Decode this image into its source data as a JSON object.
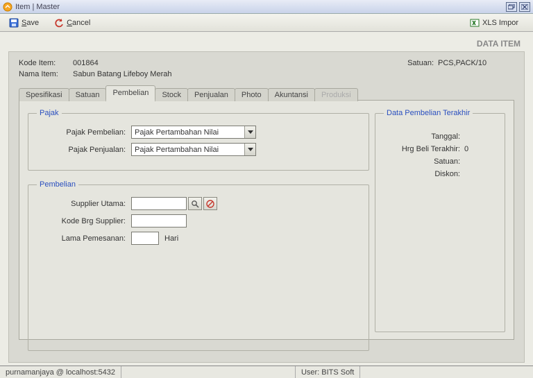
{
  "window": {
    "title": "Item | Master"
  },
  "toolbar": {
    "save_label": "Save",
    "save_key": "S",
    "cancel_label": "Cancel",
    "cancel_key": "C",
    "xls_label": "XLS Impor"
  },
  "banner": {
    "data_item": "DATA ITEM"
  },
  "header": {
    "kode_label": "Kode Item:",
    "kode_value": "001864",
    "nama_label": "Nama Item:",
    "nama_value": "Sabun Batang Lifeboy Merah",
    "satuan_label": "Satuan:",
    "satuan_value": "PCS,PACK/10"
  },
  "tabs": [
    {
      "label": "Spesifikasi",
      "active": false,
      "disabled": false
    },
    {
      "label": "Satuan",
      "active": false,
      "disabled": false
    },
    {
      "label": "Pembelian",
      "active": true,
      "disabled": false
    },
    {
      "label": "Stock",
      "active": false,
      "disabled": false
    },
    {
      "label": "Penjualan",
      "active": false,
      "disabled": false
    },
    {
      "label": "Photo",
      "active": false,
      "disabled": false
    },
    {
      "label": "Akuntansi",
      "active": false,
      "disabled": false
    },
    {
      "label": "Produksi",
      "active": false,
      "disabled": true
    }
  ],
  "pajak": {
    "legend": "Pajak",
    "pembelian_label": "Pajak Pembelian:",
    "pembelian_value": "Pajak Pertambahan Nilai",
    "penjualan_label": "Pajak Penjualan:",
    "penjualan_value": "Pajak Pertambahan Nilai"
  },
  "pembelian": {
    "legend": "Pembelian",
    "supplier_label": "Supplier Utama:",
    "supplier_value": "",
    "kode_brg_label": "Kode Brg Supplier:",
    "kode_brg_value": "",
    "lama_label": "Lama Pemesanan:",
    "lama_value": "",
    "lama_unit": "Hari"
  },
  "last_purchase": {
    "legend": "Data Pembelian Terakhir",
    "tanggal_label": "Tanggal:",
    "tanggal_value": "",
    "hrg_label": "Hrg Beli Terakhir:",
    "hrg_value": "0",
    "satuan_label": "Satuan:",
    "satuan_value": "",
    "diskon_label": "Diskon:",
    "diskon_value": ""
  },
  "status": {
    "conn": "purnamanjaya @ localhost:5432",
    "user": "User: BITS Soft"
  },
  "colors": {
    "accent": "#2a4fbf"
  }
}
